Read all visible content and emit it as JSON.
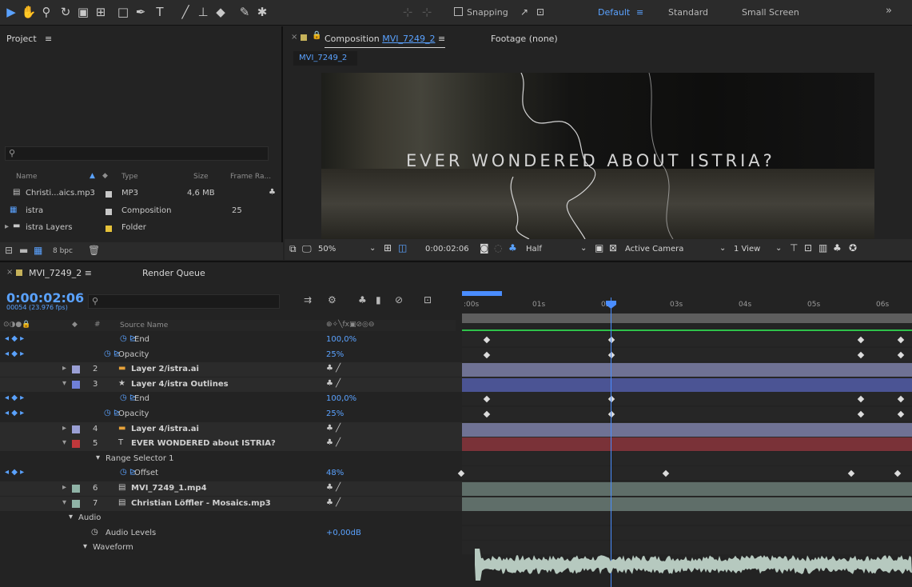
{
  "toolbar": {
    "snapping_label": "Snapping",
    "workspaces": [
      "Default",
      "Standard",
      "Small Screen"
    ],
    "more": "»"
  },
  "project": {
    "title": "Project",
    "menu": "≡",
    "columns": [
      "Name",
      "Type",
      "Size",
      "Frame Ra..."
    ],
    "items": [
      {
        "name": "Christi...aics.mp3",
        "type": "MP3",
        "size": "4,6 MB",
        "rate": "",
        "color": "#c8c8c8"
      },
      {
        "name": "istra",
        "type": "Composition",
        "size": "",
        "rate": "25",
        "color": "#c8c8c8"
      },
      {
        "name": "istra Layers",
        "type": "Folder",
        "size": "",
        "rate": "",
        "color": "#e6c23a"
      }
    ],
    "bpc": "8 bpc"
  },
  "comp": {
    "tab_label": "Composition",
    "comp_name": "MVI_7249_2",
    "footage_tab": "Footage (none)",
    "subtab": "MVI_7249_2",
    "viewer_text": "EVER WONDERED ABOUT ISTRIA?",
    "zoom": "50%",
    "timecode": "0:00:02:06",
    "resolution": "Half",
    "camera": "Active Camera",
    "views": "1 View"
  },
  "timeline": {
    "tab_label": "MVI_7249_2",
    "render_queue": "Render Queue",
    "timecode": "0:00:02:06",
    "fps": "00054 (23.976 fps)",
    "col_source": "Source Name",
    "col_switches": "⊕✧╲fx▣⊘◎⊖",
    "ruler": [
      ":00s",
      "01s",
      "02s",
      "03s",
      "04s",
      "05s",
      "06s"
    ],
    "rows": [
      {
        "kind": "prop",
        "name": "End",
        "value": "100,0%",
        "indent": 168
      },
      {
        "kind": "prop",
        "name": "Opacity",
        "value": "25%",
        "indent": 148
      },
      {
        "kind": "layer",
        "idx": "2",
        "name": "Layer 2/istra.ai",
        "color": "#9a9fd4",
        "icon": "ai",
        "bar": "#6f7294"
      },
      {
        "kind": "layer",
        "idx": "3",
        "name": "Layer 4/istra Outlines",
        "color": "#6f7fd8",
        "icon": "star",
        "bar": "#4b5494"
      },
      {
        "kind": "prop",
        "name": "End",
        "value": "100,0%",
        "indent": 168
      },
      {
        "kind": "prop",
        "name": "Opacity",
        "value": "25%",
        "indent": 148
      },
      {
        "kind": "layer",
        "idx": "4",
        "name": "Layer 4/istra.ai",
        "color": "#9a9fd4",
        "icon": "ai",
        "bar": "#6f7294"
      },
      {
        "kind": "layer",
        "idx": "5",
        "name": "EVER WONDERED about ISTRIA?",
        "color": "#c0383b",
        "icon": "T",
        "bar": "#7a3238"
      },
      {
        "kind": "group",
        "name": "Range Selector 1",
        "indent": 132
      },
      {
        "kind": "prop",
        "name": "Offset",
        "value": "48%",
        "indent": 168
      },
      {
        "kind": "layer",
        "idx": "6",
        "name": "MVI_7249_1.mp4",
        "color": "#8fb3a6",
        "icon": "file",
        "bar": "#5f6e69"
      },
      {
        "kind": "layer",
        "idx": "7",
        "name": "Christian Löffler - Mosaics.mp3",
        "color": "#8fb3a6",
        "icon": "file",
        "bar": "#5f6e69"
      },
      {
        "kind": "group",
        "name": "Audio",
        "indent": 98
      },
      {
        "kind": "prop",
        "name": "Audio Levels",
        "value": "+0,00dB",
        "indent": 132
      },
      {
        "kind": "group",
        "name": "Waveform",
        "indent": 116
      }
    ]
  }
}
